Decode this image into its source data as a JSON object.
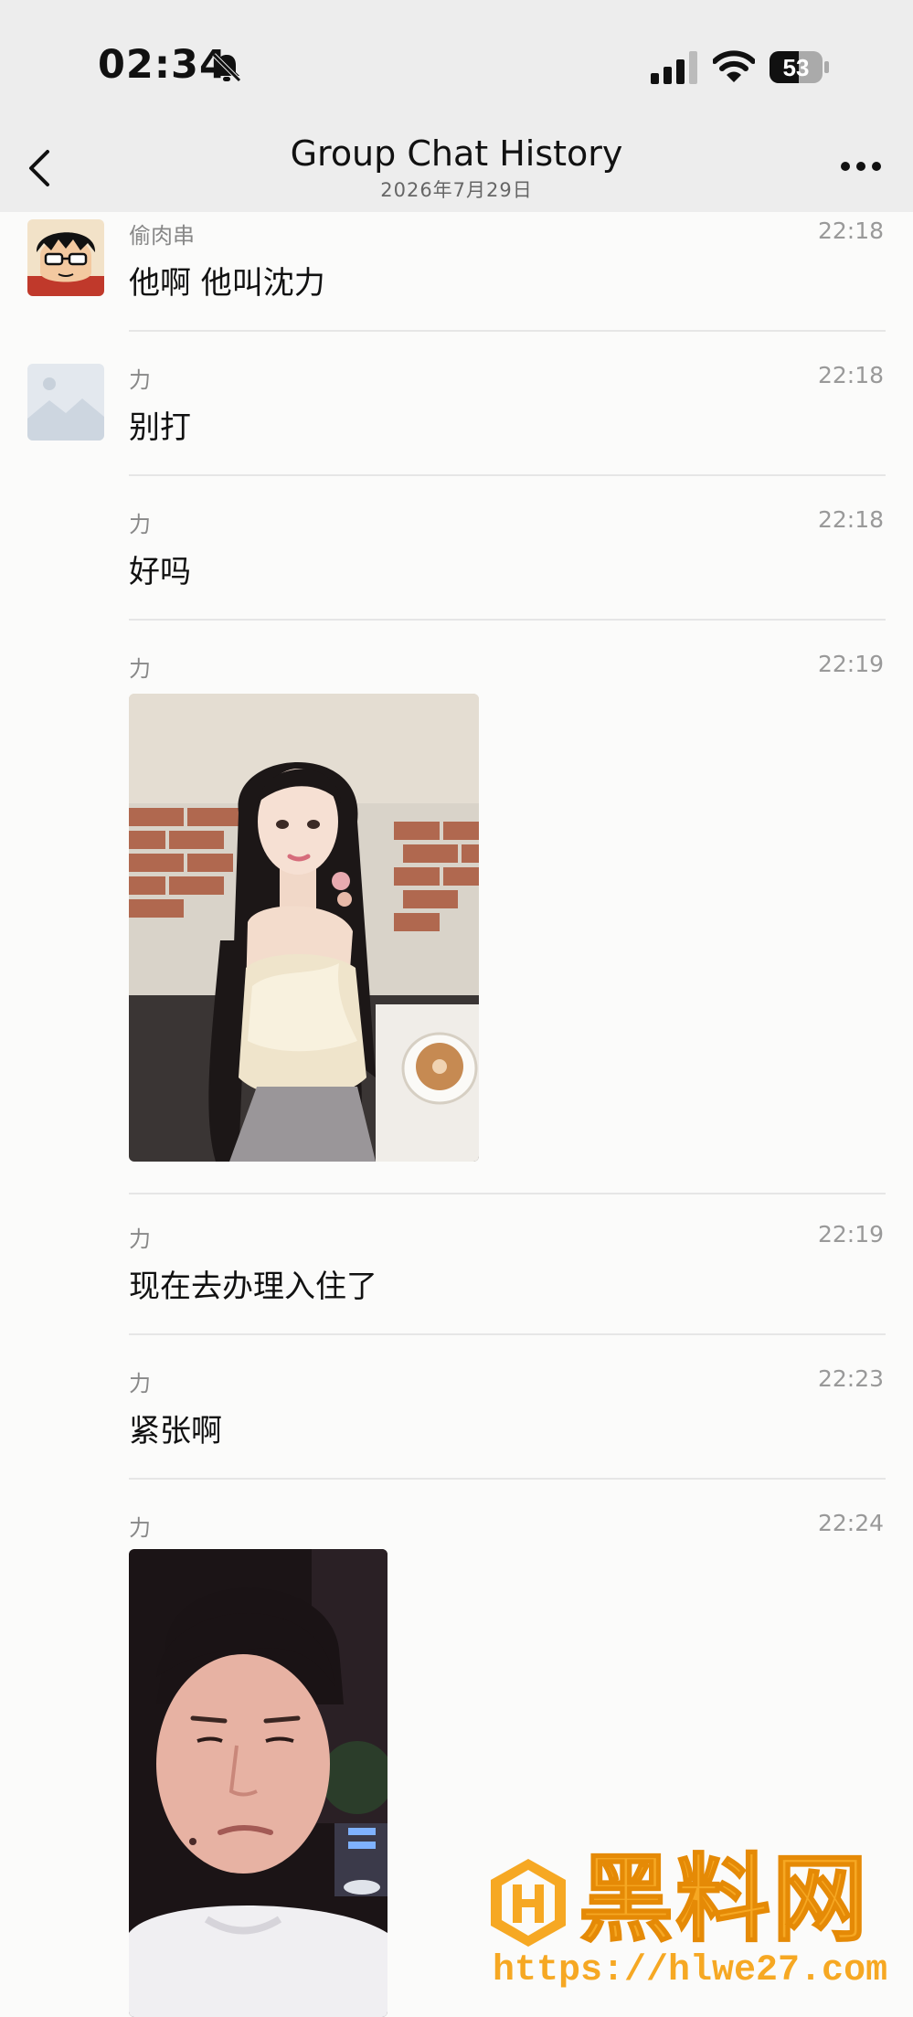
{
  "status": {
    "time": "02:34",
    "battery": "53"
  },
  "header": {
    "title": "Group Chat History",
    "subtitle": "2026年7月29日"
  },
  "messages": [
    {
      "sender": "偷肉串",
      "time": "22:18",
      "text": "他啊 他叫沈力"
    },
    {
      "sender": "力",
      "time": "22:18",
      "text": "别打"
    },
    {
      "sender": "力",
      "time": "22:18",
      "text": "好吗"
    },
    {
      "sender": "力",
      "time": "22:19",
      "image": "photo-woman"
    },
    {
      "sender": "力",
      "time": "22:19",
      "text": "现在去办理入住了"
    },
    {
      "sender": "力",
      "time": "22:23",
      "text": "紧张啊"
    },
    {
      "sender": "力",
      "time": "22:24",
      "image": "photo-man"
    }
  ],
  "watermark": {
    "name": "黑料网",
    "url": "https://hlwe27.com"
  },
  "colors": {
    "watermark": "#f6a823",
    "background": "#fbfbfa",
    "bar": "#ededed"
  }
}
